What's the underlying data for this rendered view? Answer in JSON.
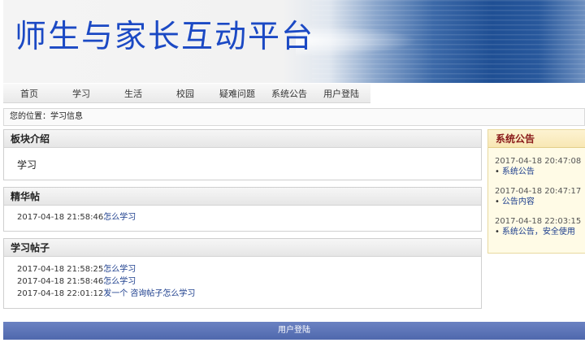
{
  "site": {
    "title": "师生与家长互动平台"
  },
  "nav": {
    "items": [
      "首页",
      "学习",
      "生活",
      "校园",
      "疑难问题",
      "系统公告",
      "用户登陆"
    ]
  },
  "breadcrumb": {
    "text": "您的位置：学习信息"
  },
  "intro_panel": {
    "title": "板块介绍",
    "content": "学习"
  },
  "featured_panel": {
    "title": "精华帖",
    "posts": [
      {
        "time": "2017-04-18 21:58:46",
        "title": "怎么学习"
      }
    ]
  },
  "posts_panel": {
    "title": "学习帖子",
    "posts": [
      {
        "time": "2017-04-18 21:58:25",
        "title": "怎么学习"
      },
      {
        "time": "2017-04-18 21:58:46",
        "title": "怎么学习"
      },
      {
        "time": "2017-04-18 22:01:12",
        "title": "发一个 咨询帖子怎么学习"
      }
    ]
  },
  "notice": {
    "title": "系统公告",
    "items": [
      {
        "time": "2017-04-18 20:47:08",
        "title": "系统公告"
      },
      {
        "time": "2017-04-18 20:47:17",
        "title": "公告内容"
      },
      {
        "time": "2017-04-18 22:03:15",
        "title": "系统公告，安全使用"
      }
    ]
  },
  "footer": {
    "text": "用户登陆"
  }
}
